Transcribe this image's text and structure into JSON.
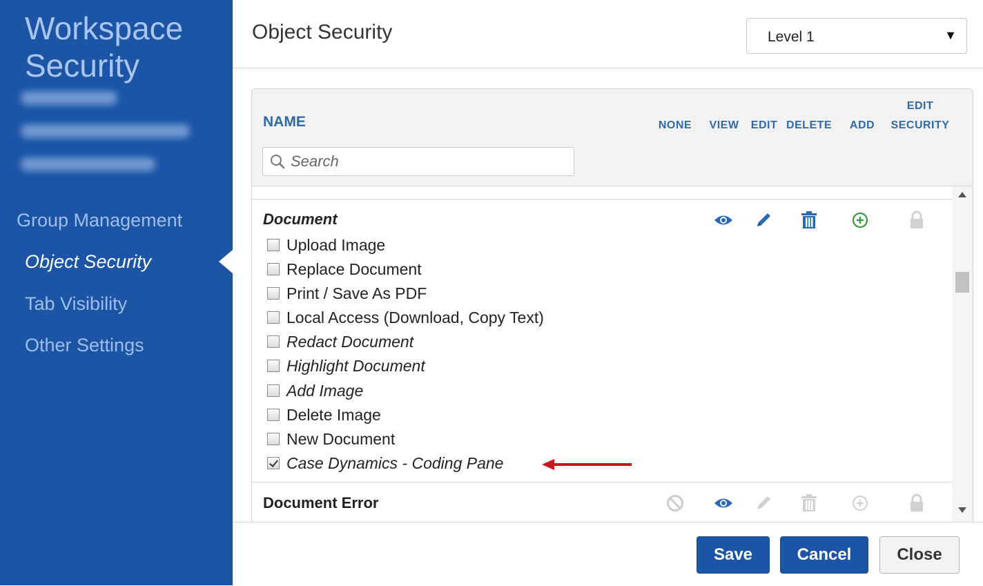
{
  "sidebar": {
    "title_line1": "Workspace",
    "title_line2": "Security",
    "nav": [
      {
        "label": "Group Management",
        "active": false
      },
      {
        "label": "Object Security",
        "active": true
      },
      {
        "label": "Tab Visibility",
        "active": false
      },
      {
        "label": "Other Settings",
        "active": false
      }
    ]
  },
  "header": {
    "title": "Object Security",
    "level_select": {
      "value": "Level 1"
    }
  },
  "table": {
    "columns": {
      "name": "NAME",
      "none": "NONE",
      "view": "VIEW",
      "edit": "EDIT",
      "delete": "DELETE",
      "add": "ADD",
      "edit_security_line1": "EDIT",
      "edit_security_line2": "SECURITY"
    },
    "search_placeholder": "Search",
    "sections": [
      {
        "title": "Document",
        "permissions": [
          "view",
          "edit",
          "delete",
          "add",
          "edit-security"
        ],
        "items": [
          {
            "label": "Upload Image",
            "checked": false,
            "italic": false
          },
          {
            "label": "Replace Document",
            "checked": false,
            "italic": false
          },
          {
            "label": "Print / Save As PDF",
            "checked": false,
            "italic": false
          },
          {
            "label": "Local Access (Download, Copy Text)",
            "checked": false,
            "italic": false
          },
          {
            "label": "Redact Document",
            "checked": false,
            "italic": true
          },
          {
            "label": "Highlight Document",
            "checked": false,
            "italic": true
          },
          {
            "label": "Add Image",
            "checked": false,
            "italic": true
          },
          {
            "label": "Delete Image",
            "checked": false,
            "italic": false
          },
          {
            "label": "New Document",
            "checked": false,
            "italic": false
          },
          {
            "label": "Case Dynamics - Coding Pane",
            "checked": true,
            "italic": true
          }
        ]
      },
      {
        "title": "Document Error",
        "permissions": [
          "view"
        ]
      }
    ]
  },
  "footer": {
    "save": "Save",
    "cancel": "Cancel",
    "close": "Close"
  },
  "colors": {
    "sidebar": "#1c55a6",
    "accent_blue": "#2e6aa8",
    "icon_active_blue": "#2868b4",
    "icon_active_green": "#3a9a3a",
    "icon_inactive": "#cccccc",
    "annotation_arrow": "#c9171e"
  }
}
